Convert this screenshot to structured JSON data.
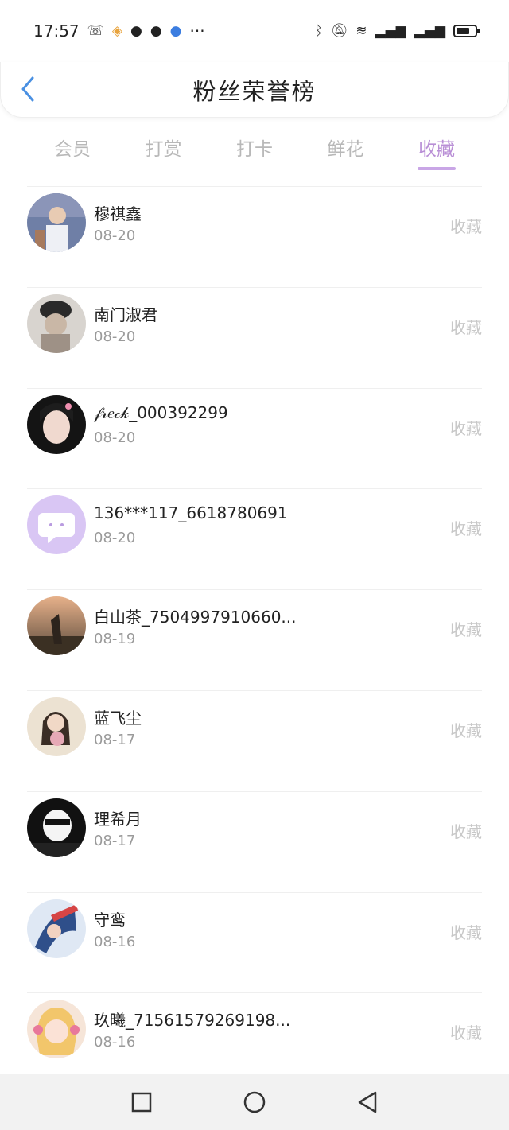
{
  "status_bar": {
    "time": "17:57",
    "more": "···"
  },
  "header": {
    "title": "粉丝荣誉榜"
  },
  "tabs": [
    {
      "label": "会员",
      "active": false
    },
    {
      "label": "打赏",
      "active": false
    },
    {
      "label": "打卡",
      "active": false
    },
    {
      "label": "鲜花",
      "active": false
    },
    {
      "label": "收藏",
      "active": true
    }
  ],
  "rows": [
    {
      "name": "穆祺鑫",
      "date": "08-20",
      "action": "收藏"
    },
    {
      "name": "南门淑君",
      "date": "08-20",
      "action": "收藏"
    },
    {
      "name": "𝒻𝓇𝑒𝒸𝓀_000392299",
      "date": "08-20",
      "action": "收藏"
    },
    {
      "name": "136***117_6618780691",
      "date": "08-20",
      "action": "收藏"
    },
    {
      "name": "白山茶_7504997910660...",
      "date": "08-19",
      "action": "收藏"
    },
    {
      "name": "蓝飞尘",
      "date": "08-17",
      "action": "收藏"
    },
    {
      "name": "理希月",
      "date": "08-17",
      "action": "收藏"
    },
    {
      "name": "守鸾",
      "date": "08-16",
      "action": "收藏"
    },
    {
      "name": "玖曦_71561579269198...",
      "date": "08-16",
      "action": "收藏"
    }
  ],
  "colors": {
    "accent": "#b98fd6",
    "back_arrow": "#4a90e2",
    "muted": "#c8c8c8"
  }
}
